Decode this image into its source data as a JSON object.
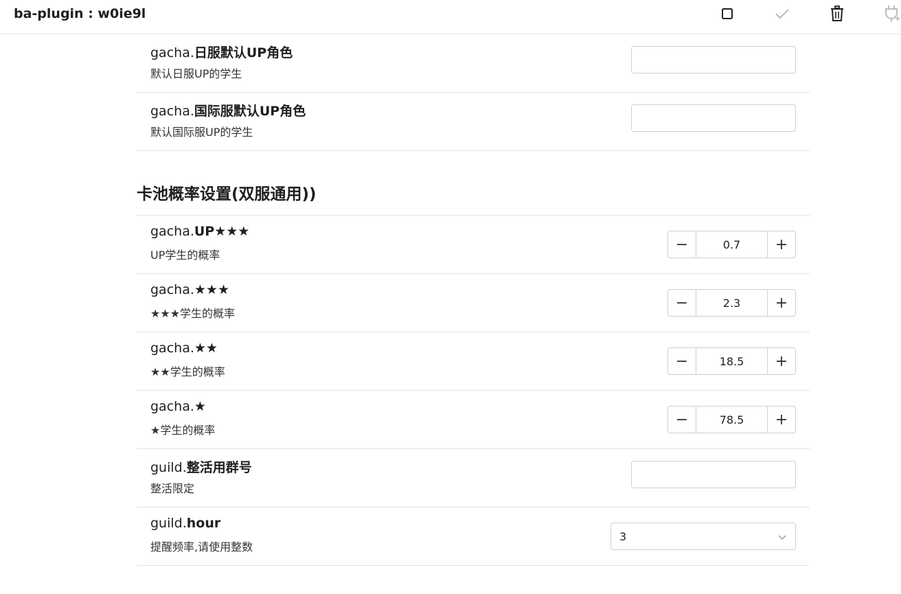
{
  "header": {
    "title": "ba-plugin : w0ie9l",
    "icons": [
      "square-icon",
      "check-icon",
      "trash-icon",
      "plug-icon"
    ]
  },
  "rows_top": [
    {
      "prefix": "gacha.",
      "name": "日服默认UP角色",
      "desc": "默认日服UP的学生",
      "value": ""
    },
    {
      "prefix": "gacha.",
      "name": "国际服默认UP角色",
      "desc": "默认国际服UP的学生",
      "value": ""
    }
  ],
  "section": {
    "title": "卡池概率设置(双服通用))"
  },
  "rows_prob": [
    {
      "prefix": "gacha.",
      "name": "UP★★★",
      "desc": "UP学生的概率",
      "value": "0.7"
    },
    {
      "prefix": "gacha.",
      "name": "★★★",
      "desc": "★★★学生的概率",
      "value": "2.3"
    },
    {
      "prefix": "gacha.",
      "name": "★★",
      "desc": "★★学生的概率",
      "value": "18.5"
    },
    {
      "prefix": "gacha.",
      "name": "★",
      "desc": "★学生的概率",
      "value": "78.5"
    }
  ],
  "guild_group": {
    "prefix": "guild.",
    "name": "整活用群号",
    "desc": "整活限定",
    "value": ""
  },
  "guild_hour": {
    "prefix": "guild.",
    "name": "hour",
    "desc": "提醒频率,请使用整数",
    "value": "3"
  },
  "stepper": {
    "minus": "−",
    "plus": "+"
  }
}
